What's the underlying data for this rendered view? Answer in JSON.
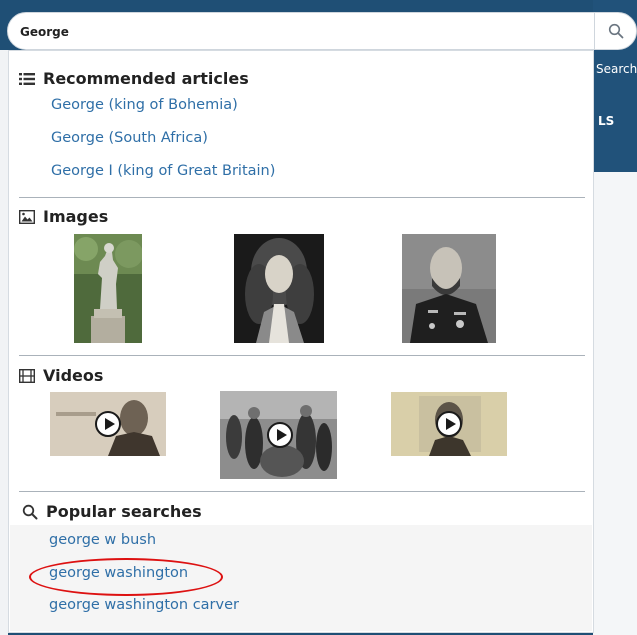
{
  "search": {
    "value": "George"
  },
  "background": {
    "search_label": "Search",
    "tab_fragment": "LS"
  },
  "dropdown": {
    "recommended": {
      "title": "Recommended articles",
      "items": [
        {
          "label": "George (king of Bohemia)"
        },
        {
          "label": "George (South Africa)"
        },
        {
          "label": "George I (king of Great Britain)"
        }
      ]
    },
    "images": {
      "title": "Images",
      "items": [
        {
          "subject": "statue"
        },
        {
          "subject": "portrait with wig"
        },
        {
          "subject": "bearded man in uniform"
        }
      ]
    },
    "videos": {
      "title": "Videos",
      "items": [
        {
          "subject": "portrait engraving"
        },
        {
          "subject": "crowd photo"
        },
        {
          "subject": "portrait photo"
        }
      ]
    },
    "popular": {
      "title": "Popular searches",
      "items": [
        {
          "label": "george w bush"
        },
        {
          "label": "george washington"
        },
        {
          "label": "george washington carver"
        }
      ]
    }
  },
  "annotation": {
    "highlight_color": "#dd1111"
  },
  "colors": {
    "link": "#2f6fa7",
    "page_bg": "#1f4f75"
  }
}
